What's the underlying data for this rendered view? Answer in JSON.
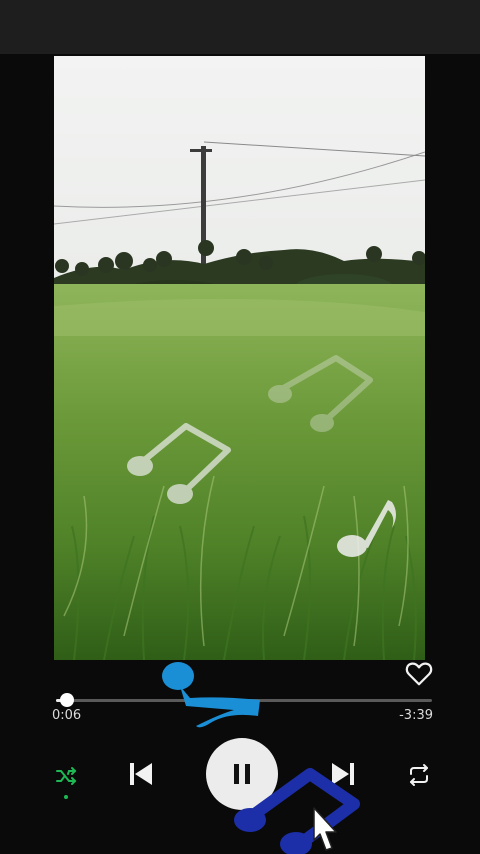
{
  "player": {
    "elapsed": "0:06",
    "remaining": "-3:39",
    "progress": 0.03,
    "liked": false,
    "shuffle_active": true,
    "is_playing": true
  },
  "icons": {
    "like": "heart-outline-icon",
    "shuffle": "shuffle-icon",
    "previous": "skip-previous-icon",
    "play_pause": "pause-icon",
    "next": "skip-next-icon",
    "repeat": "repeat-icon",
    "overlay": "music-note-icon"
  },
  "colors": {
    "accent": "#1db954",
    "background": "#0a0a0a",
    "overlay_blue_light": "#1a8fd6",
    "overlay_blue_dark": "#1d2fa8"
  }
}
